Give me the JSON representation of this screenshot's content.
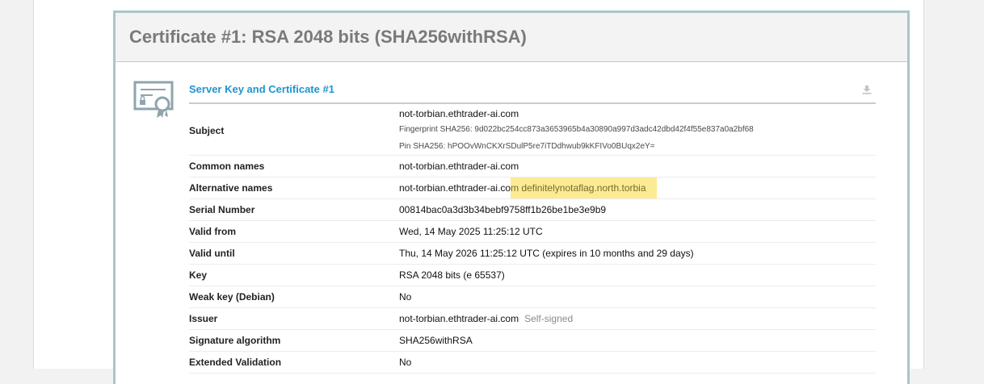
{
  "report": {
    "title": "Certificate #1: RSA 2048 bits (SHA256withRSA)"
  },
  "section": {
    "title": "Server Key and Certificate #1",
    "download_icon": "download-icon",
    "cert_icon": "certificate-icon"
  },
  "subject": {
    "label": "Subject",
    "value": "not-torbian.ethtrader-ai.com",
    "fingerprint": "Fingerprint SHA256: 9d022bc254cc873a3653965b4a30890a997d3adc42dbd42f4f55e837a0a2bf68",
    "pin": "Pin SHA256: hPOOvWnCKXrSDulP5re7iTDdhwub9kKFIVo0BUqx2eY="
  },
  "rows": {
    "common_names": {
      "label": "Common names",
      "value": "not-torbian.ethtrader-ai.com"
    },
    "alt_names": {
      "label": "Alternative names",
      "value_a": "not-torbian.ethtrader-ai.co",
      "value_b": "m definitelynotaflag.north.torbia"
    },
    "serial": {
      "label": "Serial Number",
      "value": "00814bac0a3d3b34bebf9758ff1b26be1be3e9b9"
    },
    "valid_from": {
      "label": "Valid from",
      "value": "Wed, 14 May 2025 11:25:12 UTC"
    },
    "valid_until": {
      "label": "Valid until",
      "value": "Thu, 14 May 2026 11:25:12 UTC (expires in 10 months and 29 days)"
    },
    "key": {
      "label": "Key",
      "value": "RSA 2048 bits (e 65537)"
    },
    "weak_key": {
      "label": "Weak key (Debian)",
      "value": "No"
    },
    "issuer": {
      "label": "Issuer",
      "value": "not-torbian.ethtrader-ai.com",
      "note": "Self-signed"
    },
    "sig_alg": {
      "label": "Signature algorithm",
      "value": "SHA256withRSA"
    },
    "ev": {
      "label": "Extended Validation",
      "value": "No"
    }
  },
  "colors": {
    "accent": "#1f95d0",
    "frame": "#a9c7c6",
    "highlight": "#fbeb94"
  }
}
